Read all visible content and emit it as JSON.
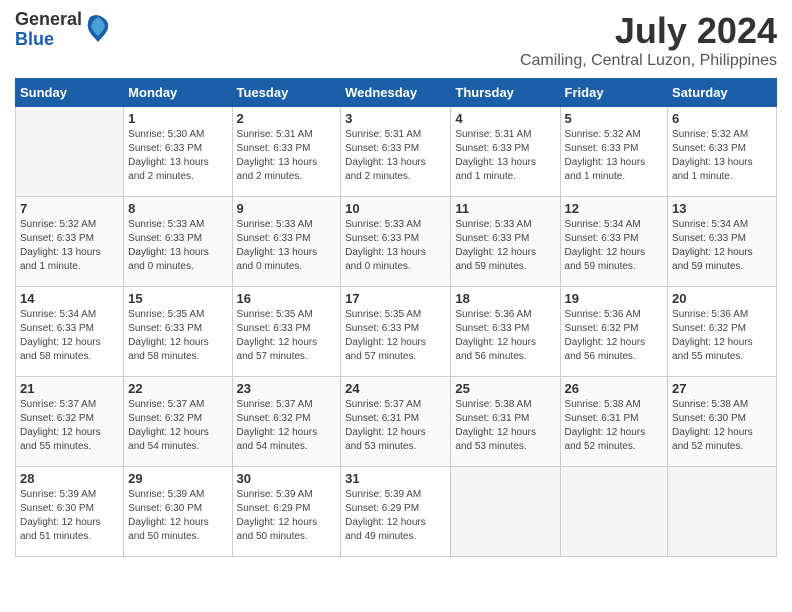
{
  "logo": {
    "general": "General",
    "blue": "Blue"
  },
  "title": "July 2024",
  "subtitle": "Camiling, Central Luzon, Philippines",
  "weekdays": [
    "Sunday",
    "Monday",
    "Tuesday",
    "Wednesday",
    "Thursday",
    "Friday",
    "Saturday"
  ],
  "weeks": [
    [
      {
        "day": "",
        "info": ""
      },
      {
        "day": "1",
        "info": "Sunrise: 5:30 AM\nSunset: 6:33 PM\nDaylight: 13 hours\nand 2 minutes."
      },
      {
        "day": "2",
        "info": "Sunrise: 5:31 AM\nSunset: 6:33 PM\nDaylight: 13 hours\nand 2 minutes."
      },
      {
        "day": "3",
        "info": "Sunrise: 5:31 AM\nSunset: 6:33 PM\nDaylight: 13 hours\nand 2 minutes."
      },
      {
        "day": "4",
        "info": "Sunrise: 5:31 AM\nSunset: 6:33 PM\nDaylight: 13 hours\nand 1 minute."
      },
      {
        "day": "5",
        "info": "Sunrise: 5:32 AM\nSunset: 6:33 PM\nDaylight: 13 hours\nand 1 minute."
      },
      {
        "day": "6",
        "info": "Sunrise: 5:32 AM\nSunset: 6:33 PM\nDaylight: 13 hours\nand 1 minute."
      }
    ],
    [
      {
        "day": "7",
        "info": "Sunrise: 5:32 AM\nSunset: 6:33 PM\nDaylight: 13 hours\nand 1 minute."
      },
      {
        "day": "8",
        "info": "Sunrise: 5:33 AM\nSunset: 6:33 PM\nDaylight: 13 hours\nand 0 minutes."
      },
      {
        "day": "9",
        "info": "Sunrise: 5:33 AM\nSunset: 6:33 PM\nDaylight: 13 hours\nand 0 minutes."
      },
      {
        "day": "10",
        "info": "Sunrise: 5:33 AM\nSunset: 6:33 PM\nDaylight: 13 hours\nand 0 minutes."
      },
      {
        "day": "11",
        "info": "Sunrise: 5:33 AM\nSunset: 6:33 PM\nDaylight: 12 hours\nand 59 minutes."
      },
      {
        "day": "12",
        "info": "Sunrise: 5:34 AM\nSunset: 6:33 PM\nDaylight: 12 hours\nand 59 minutes."
      },
      {
        "day": "13",
        "info": "Sunrise: 5:34 AM\nSunset: 6:33 PM\nDaylight: 12 hours\nand 59 minutes."
      }
    ],
    [
      {
        "day": "14",
        "info": "Sunrise: 5:34 AM\nSunset: 6:33 PM\nDaylight: 12 hours\nand 58 minutes."
      },
      {
        "day": "15",
        "info": "Sunrise: 5:35 AM\nSunset: 6:33 PM\nDaylight: 12 hours\nand 58 minutes."
      },
      {
        "day": "16",
        "info": "Sunrise: 5:35 AM\nSunset: 6:33 PM\nDaylight: 12 hours\nand 57 minutes."
      },
      {
        "day": "17",
        "info": "Sunrise: 5:35 AM\nSunset: 6:33 PM\nDaylight: 12 hours\nand 57 minutes."
      },
      {
        "day": "18",
        "info": "Sunrise: 5:36 AM\nSunset: 6:33 PM\nDaylight: 12 hours\nand 56 minutes."
      },
      {
        "day": "19",
        "info": "Sunrise: 5:36 AM\nSunset: 6:32 PM\nDaylight: 12 hours\nand 56 minutes."
      },
      {
        "day": "20",
        "info": "Sunrise: 5:36 AM\nSunset: 6:32 PM\nDaylight: 12 hours\nand 55 minutes."
      }
    ],
    [
      {
        "day": "21",
        "info": "Sunrise: 5:37 AM\nSunset: 6:32 PM\nDaylight: 12 hours\nand 55 minutes."
      },
      {
        "day": "22",
        "info": "Sunrise: 5:37 AM\nSunset: 6:32 PM\nDaylight: 12 hours\nand 54 minutes."
      },
      {
        "day": "23",
        "info": "Sunrise: 5:37 AM\nSunset: 6:32 PM\nDaylight: 12 hours\nand 54 minutes."
      },
      {
        "day": "24",
        "info": "Sunrise: 5:37 AM\nSunset: 6:31 PM\nDaylight: 12 hours\nand 53 minutes."
      },
      {
        "day": "25",
        "info": "Sunrise: 5:38 AM\nSunset: 6:31 PM\nDaylight: 12 hours\nand 53 minutes."
      },
      {
        "day": "26",
        "info": "Sunrise: 5:38 AM\nSunset: 6:31 PM\nDaylight: 12 hours\nand 52 minutes."
      },
      {
        "day": "27",
        "info": "Sunrise: 5:38 AM\nSunset: 6:30 PM\nDaylight: 12 hours\nand 52 minutes."
      }
    ],
    [
      {
        "day": "28",
        "info": "Sunrise: 5:39 AM\nSunset: 6:30 PM\nDaylight: 12 hours\nand 51 minutes."
      },
      {
        "day": "29",
        "info": "Sunrise: 5:39 AM\nSunset: 6:30 PM\nDaylight: 12 hours\nand 50 minutes."
      },
      {
        "day": "30",
        "info": "Sunrise: 5:39 AM\nSunset: 6:29 PM\nDaylight: 12 hours\nand 50 minutes."
      },
      {
        "day": "31",
        "info": "Sunrise: 5:39 AM\nSunset: 6:29 PM\nDaylight: 12 hours\nand 49 minutes."
      },
      {
        "day": "",
        "info": ""
      },
      {
        "day": "",
        "info": ""
      },
      {
        "day": "",
        "info": ""
      }
    ]
  ]
}
